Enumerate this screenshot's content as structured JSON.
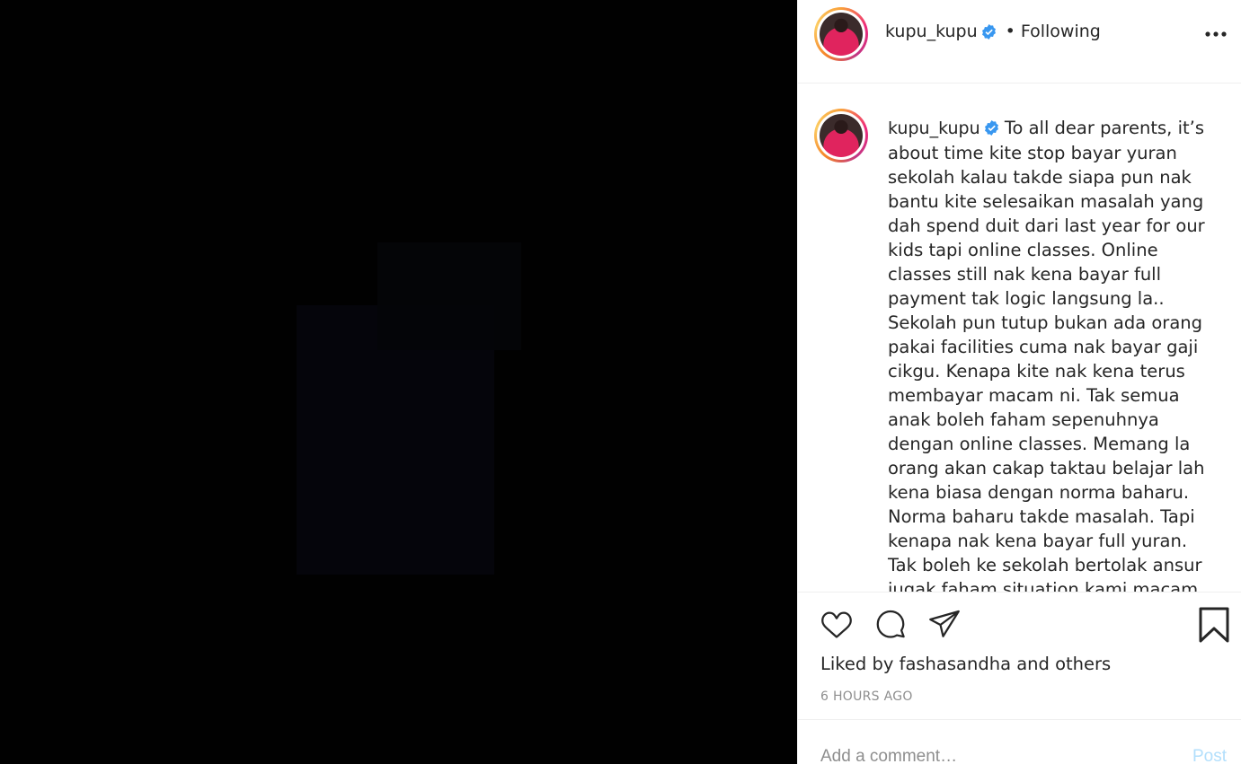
{
  "post": {
    "username": "kupu_kupu",
    "following_label": "Following",
    "separator": "•",
    "more_icon": "ellipsis-icon",
    "caption": "To all dear parents, it’s about time kite stop bayar yuran sekolah kalau takde siapa pun nak bantu kite selesaikan masalah yang dah spend duit dari last year for our kids tapi online classes. Online classes still nak kena bayar full payment tak logic langsung la.. Sekolah pun tutup bukan ada orang pakai facilities cuma nak bayar gaji cikgu. Kenapa kite nak kena terus membayar macam ni. Tak semua anak boleh faham sepenuhnya dengan online classes. Memang la orang akan cakap taktau belajar lah kena biasa dengan norma baharu. Norma baharu takde masalah. Tapi kenapa nak kena bayar full yuran. Tak boleh ke sekolah bertolak ansur jugak faham situation kami macam kami faham situation korang nak kena",
    "liked_by_prefix": "Liked by",
    "liked_by_user": "fashasandha",
    "liked_by_and": "and",
    "liked_by_others": "others",
    "time_ago": "6 HOURS AGO",
    "comment_placeholder": "Add a comment…",
    "post_label": "Post"
  },
  "colors": {
    "verified": "#3897f0",
    "text": "#262626",
    "muted": "#8e8e8e",
    "post_disabled": "#b2dffc"
  }
}
